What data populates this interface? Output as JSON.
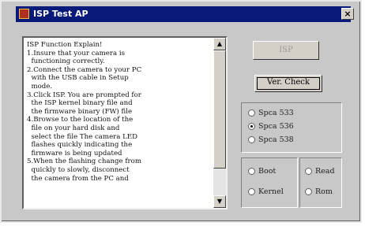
{
  "window": {
    "title": "ISP Test AP",
    "close_label": "×"
  },
  "explain_text": "ISP Function Explain!\n1.Insure that your camera is\n  functioning correctly.\n2.Connect the camera to your PC\n  with the USB cable in Setup\n  mode.\n3.Click ISP. You are prompted for\n  the ISP kernel binary file and\n  the firmware binary (FW) file\n4.Browse to the location of the\n  file on your hard disk and\n  select the file The camera LED\n  flashes quickly indicating the\n  firmware is being updated\n5.When the flashing change from\n  quickly to slowly, disconnect\n  the camera from the PC and",
  "buttons": {
    "isp": "ISP",
    "ver_check": "Ver. Check"
  },
  "spca_options": [
    {
      "label": "Spca 533",
      "checked": false
    },
    {
      "label": "Spca 536",
      "checked": true
    },
    {
      "label": "Spca 538",
      "checked": false
    }
  ],
  "mode_options": [
    {
      "label": "Boot",
      "checked": false
    },
    {
      "label": "Kernel",
      "checked": false
    }
  ],
  "rw_options": [
    {
      "label": "Read",
      "checked": false
    },
    {
      "label": "Rom",
      "checked": false
    }
  ]
}
